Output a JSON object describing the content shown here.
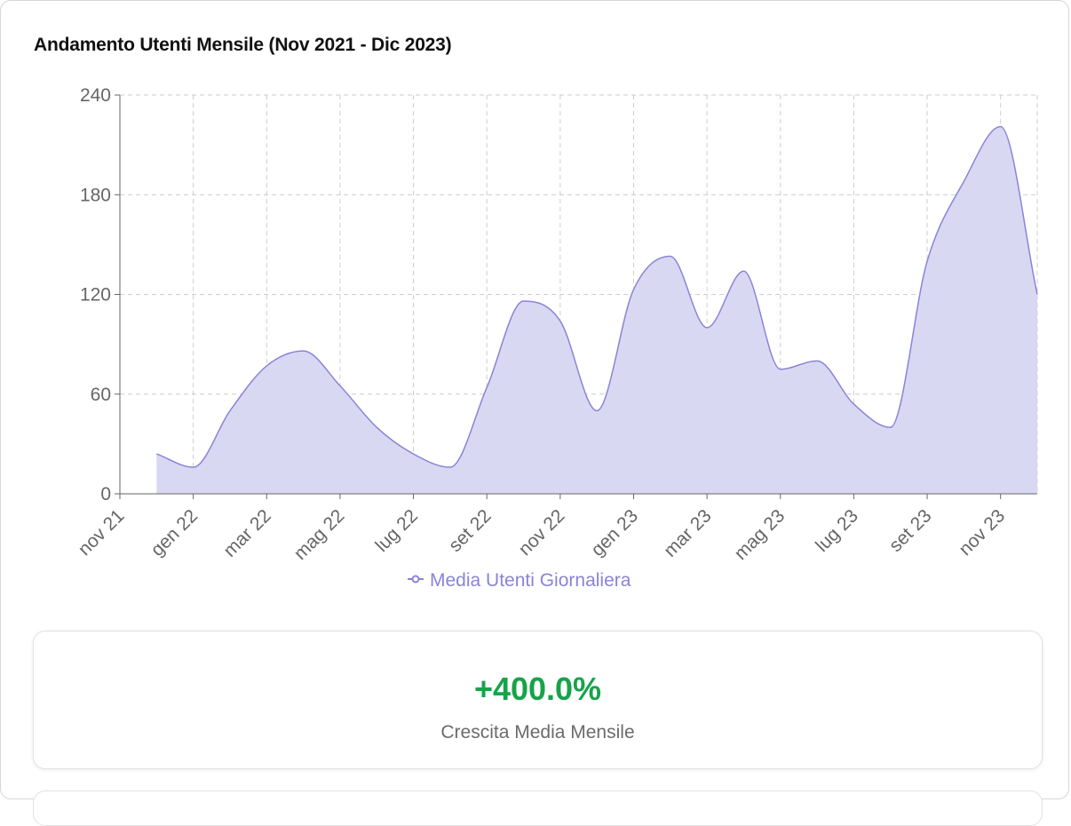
{
  "title": "Andamento Utenti Mensile (Nov 2021 - Dic 2023)",
  "chart_data": {
    "type": "area",
    "x": [
      "nov 21",
      "dic 21",
      "gen 22",
      "feb 22",
      "mar 22",
      "apr 22",
      "mag 22",
      "giu 22",
      "lug 22",
      "ago 22",
      "set 22",
      "ott 22",
      "nov 22",
      "dic 22",
      "gen 23",
      "feb 23",
      "mar 23",
      "apr 23",
      "mag 23",
      "giu 23",
      "lug 23",
      "ago 23",
      "set 23",
      "ott 23",
      "nov 23",
      "dic 23"
    ],
    "xticks": [
      "nov 21",
      "gen 22",
      "mar 22",
      "mag 22",
      "lug 22",
      "set 22",
      "nov 22",
      "gen 23",
      "mar 23",
      "mag 23",
      "lug 23",
      "set 23",
      "nov 23"
    ],
    "series": [
      {
        "name": "Media Utenti Giornaliera",
        "x_start_index": 1,
        "values": [
          24,
          16,
          50,
          77,
          86,
          65,
          40,
          24,
          16,
          64,
          116,
          104,
          50,
          123,
          143,
          100,
          134,
          75,
          80,
          54,
          40,
          140,
          188,
          221,
          120
        ],
        "color": "#8884d8",
        "fill": "#d9d8f2"
      }
    ],
    "ylim": [
      0,
      240
    ],
    "yticks": [
      0,
      60,
      120,
      180,
      240
    ],
    "grid": true,
    "grid_style": "dashed",
    "legend": "bottom-center"
  },
  "stat": {
    "value": "+400.0%",
    "label": "Crescita Media Mensile",
    "color": "#16a34a"
  }
}
